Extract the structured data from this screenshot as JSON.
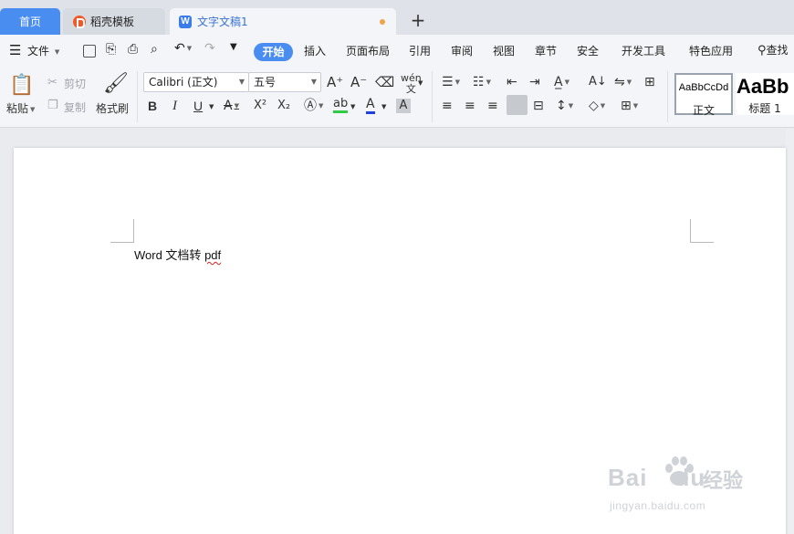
{
  "tabs": {
    "home": "首页",
    "template": "稻壳模板",
    "document": "文字文稿1",
    "new_tab": "+"
  },
  "menu": {
    "file": "文件",
    "items": [
      "开始",
      "插入",
      "页面布局",
      "引用",
      "审阅",
      "视图",
      "章节",
      "安全",
      "开发工具",
      "特色应用"
    ],
    "active": "开始",
    "search": "查找"
  },
  "ribbon": {
    "paste": "粘贴",
    "cut": "剪切",
    "copy": "复制",
    "format_painter": "格式刷",
    "font_name": "Calibri (正文)",
    "font_size": "五号",
    "bold": "B",
    "italic": "I",
    "underline": "U",
    "styles": [
      {
        "sample": "AaBbCcDd",
        "name": "正文"
      },
      {
        "sample": "AaBb",
        "name": "标题 1"
      }
    ]
  },
  "document": {
    "text_plain": "Word  文档转 ",
    "text_misspelled": "pdf"
  },
  "watermark": {
    "logo": "Bai",
    "logo_suffix": "du",
    "cn": "经验",
    "url": "jingyan.baidu.com"
  },
  "colors": {
    "accent": "#4a8df1",
    "tab_bar": "#dfe3e9",
    "ribbon_bg": "#f3f5f8",
    "highlight_green": "#2ecc40",
    "font_color_blue": "#1f3fe0",
    "spellcheck_red": "#e02020"
  }
}
